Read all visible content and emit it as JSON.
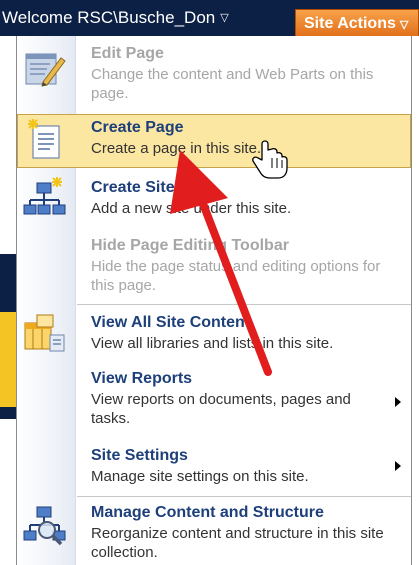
{
  "topbar": {
    "welcome": "Welcome RSC\\Busche_Don",
    "site_actions": "Site Actions",
    "caret": "▽"
  },
  "menu": {
    "items": [
      {
        "title": "Edit Page",
        "desc": "Change the content and Web Parts on this page.",
        "icon": "edit-page-icon",
        "state": "disabled"
      },
      {
        "title": "Create Page",
        "desc": "Create a page in this site.",
        "icon": "create-page-icon",
        "state": "highlighted"
      },
      {
        "title": "Create Site",
        "desc": "Add a new site under this site.",
        "icon": "create-site-icon",
        "state": "normal"
      },
      {
        "title": "Hide Page Editing Toolbar",
        "desc": "Hide the page status and editing options for this page.",
        "icon": "",
        "state": "disabled"
      },
      {
        "title": "View All Site Content",
        "desc": "View all libraries and lists in this site.",
        "icon": "view-all-content-icon",
        "state": "normal"
      },
      {
        "title": "View Reports",
        "desc": "View reports on documents, pages and tasks.",
        "icon": "",
        "state": "submenu"
      },
      {
        "title": "Site Settings",
        "desc": "Manage site settings on this site.",
        "icon": "",
        "state": "submenu"
      },
      {
        "title": "Manage Content and Structure",
        "desc": "Reorganize content and structure in this site collection.",
        "icon": "manage-content-icon",
        "state": "normal"
      }
    ]
  },
  "colors": {
    "top_bar": "#0c1f45",
    "site_actions": "#e2701c",
    "highlight": "#fbe6a2",
    "title_link": "#1d3f7a",
    "annotation_arrow": "#e11d1d"
  }
}
